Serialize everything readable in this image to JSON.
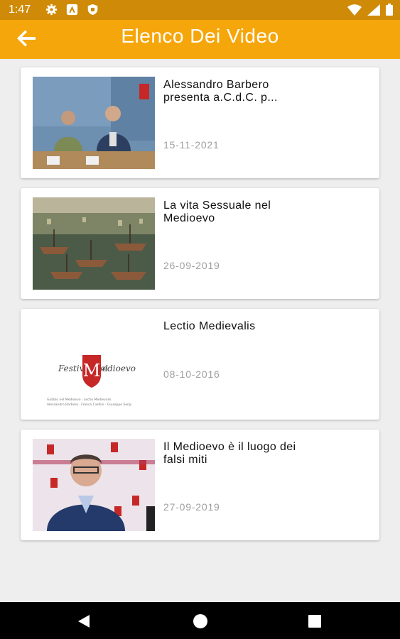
{
  "status_bar": {
    "time": "1:47",
    "left_icons": [
      "settings-icon",
      "android-auto-icon",
      "shield-icon"
    ],
    "right_icons": [
      "wifi-icon",
      "signal-icon",
      "battery-icon"
    ]
  },
  "app_bar": {
    "title": "Elenco Dei Video",
    "back_icon": "arrow-back-icon",
    "color": "#f5a60a"
  },
  "videos": [
    {
      "title": "Alessandro Barbero presenta a.C.d.C. p...",
      "date": "15-11-2021",
      "thumb": "conference-photo"
    },
    {
      "title": "La vita Sessuale nel Medioevo",
      "date": "26-09-2019",
      "thumb": "naval-battle-painting"
    },
    {
      "title": "Lectio Medievalis",
      "date": "08-10-2016",
      "thumb": "festival-logo",
      "logo_text_left": "Festival del",
      "logo_letter": "M",
      "logo_text_right": "edioevo",
      "caption_line1": "Gubbio nel Medioevo · Lectio Medievalis",
      "caption_line2": "Alessandro Barbero · Franco Cardini · Giuseppe Sergi"
    },
    {
      "title": "Il Medioevo è il luogo dei falsi miti",
      "date": "27-09-2019",
      "thumb": "interview-photo"
    }
  ],
  "nav_bar": {
    "icons": [
      "back-triangle-icon",
      "home-circle-icon",
      "recents-square-icon"
    ]
  }
}
